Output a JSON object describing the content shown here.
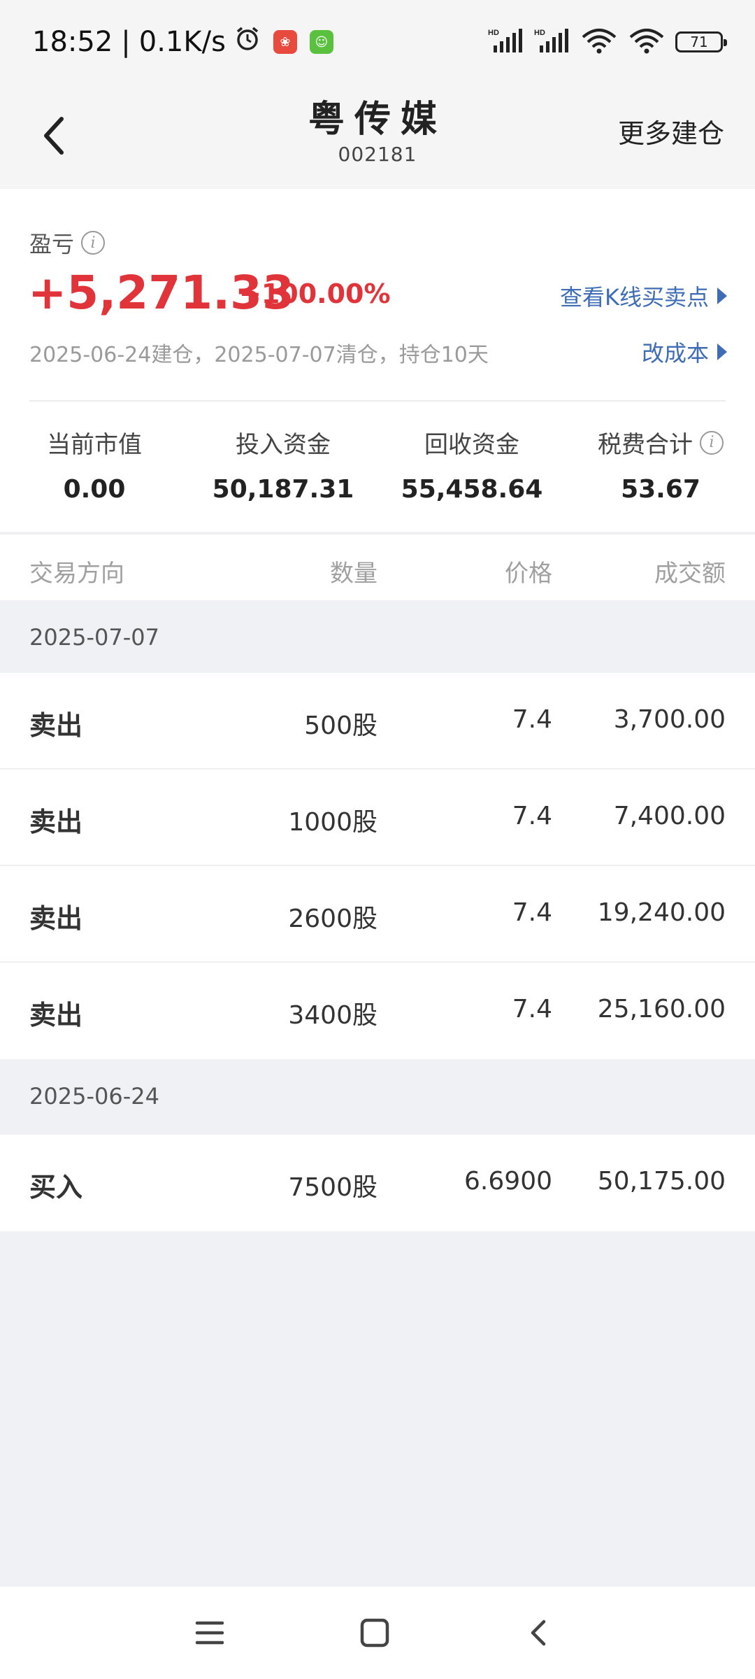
{
  "status_bar": {
    "time": "18:52",
    "net_speed": "0.1K/s",
    "battery": "71",
    "icons": [
      "alarm-icon",
      "app-notification-icon",
      "cat-app-icon",
      "signal-hd-icon",
      "signal-hd-icon",
      "wifi-icon",
      "wifi-icon",
      "battery-icon"
    ]
  },
  "header": {
    "title": "粤传媒",
    "code": "002181",
    "more_label": "更多建仓"
  },
  "summary": {
    "pl_label": "盈亏",
    "pl_value": "+5,271.33",
    "pl_percent": "+100.00%",
    "kline_link": "查看K线买卖点",
    "hold_info": "2025-06-24建仓，2025-07-07清仓，持仓10天",
    "cost_link": "改成本",
    "stats": [
      {
        "label": "当前市值",
        "value": "0.00"
      },
      {
        "label": "投入资金",
        "value": "50,187.31"
      },
      {
        "label": "回收资金",
        "value": "55,458.64"
      },
      {
        "label": "税费合计",
        "value": "53.67"
      }
    ]
  },
  "table": {
    "headers": [
      "交易方向",
      "数量",
      "价格",
      "成交额"
    ],
    "groups": [
      {
        "date": "2025-07-07",
        "rows": [
          {
            "direction": "卖出",
            "qty": "500股",
            "price": "7.4",
            "amount": "3,700.00"
          },
          {
            "direction": "卖出",
            "qty": "1000股",
            "price": "7.4",
            "amount": "7,400.00"
          },
          {
            "direction": "卖出",
            "qty": "2600股",
            "price": "7.4",
            "amount": "19,240.00"
          },
          {
            "direction": "卖出",
            "qty": "3400股",
            "price": "7.4",
            "amount": "25,160.00"
          }
        ]
      },
      {
        "date": "2025-06-24",
        "rows": [
          {
            "direction": "买入",
            "qty": "7500股",
            "price": "6.6900",
            "amount": "50,175.00"
          }
        ]
      }
    ]
  },
  "colors": {
    "profit_red": "#e0343a",
    "sell_blue": "#3d8de0",
    "buy_red": "#e0474b",
    "link_blue": "#3e6db5"
  },
  "nav_bar": [
    "menu-icon",
    "home-icon",
    "back-icon"
  ]
}
